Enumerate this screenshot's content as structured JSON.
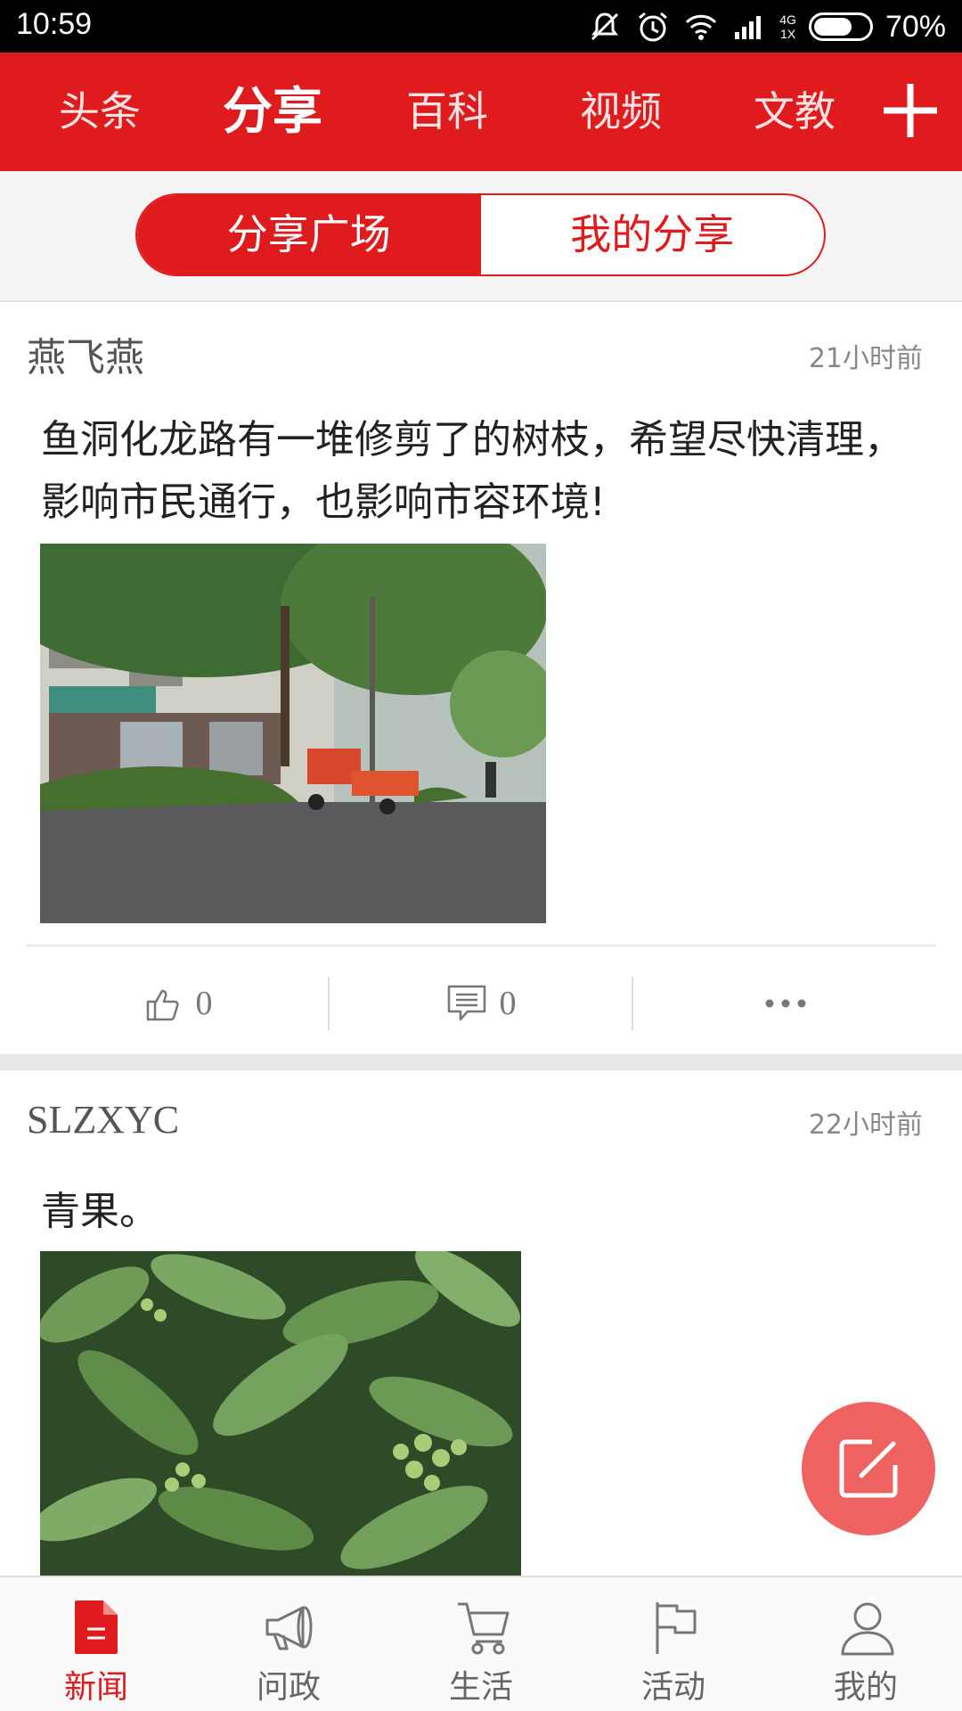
{
  "status_bar": {
    "time": "10:59",
    "network_top": "4G",
    "network_bottom": "1X",
    "battery": "70%",
    "battery_level": 0.7
  },
  "top_nav": {
    "tabs": [
      {
        "label": "头条",
        "active": false
      },
      {
        "label": "分享",
        "active": true
      },
      {
        "label": "百科",
        "active": false
      },
      {
        "label": "视频",
        "active": false
      },
      {
        "label": "文教",
        "active": false
      }
    ],
    "add_icon": "plus-icon"
  },
  "segment": {
    "left": "分享广场",
    "right": "我的分享",
    "selected": "分享广场"
  },
  "posts": [
    {
      "author": "燕飞燕",
      "time": "21小时前",
      "text": "鱼洞化龙路有一堆修剪了的树枝，希望尽快清理，影响市民通行，也影响市容环境!",
      "likes": "0",
      "comments": "0"
    },
    {
      "author": "SLZXYC",
      "time": "22小时前",
      "text": "青果。"
    }
  ],
  "fab": {
    "icon": "compose-icon"
  },
  "bottom_nav": [
    {
      "label": "新闻",
      "icon": "news-icon",
      "active": true
    },
    {
      "label": "问政",
      "icon": "megaphone-icon",
      "active": false
    },
    {
      "label": "生活",
      "icon": "cart-icon",
      "active": false
    },
    {
      "label": "活动",
      "icon": "flag-icon",
      "active": false
    },
    {
      "label": "我的",
      "icon": "user-icon",
      "active": false
    }
  ],
  "colors": {
    "brand_red": "#df1b1e",
    "fab": "#ee6262"
  }
}
